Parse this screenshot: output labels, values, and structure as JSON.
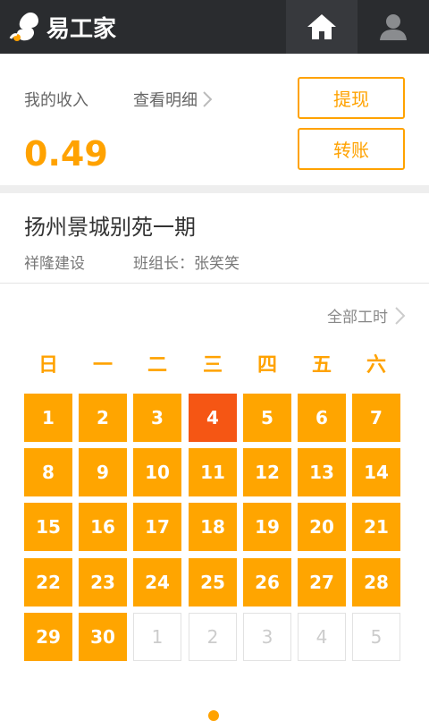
{
  "header": {
    "app_name": "易工家",
    "home_icon": "home-icon",
    "user_icon": "user-icon"
  },
  "income": {
    "label": "我的收入",
    "detail_link": "查看明细",
    "amount": "0.49",
    "withdraw_button": "提现",
    "transfer_button": "转账"
  },
  "project": {
    "name": "扬州景城别苑一期",
    "company": "祥隆建设",
    "leader": "班组长：张笑笑"
  },
  "all_hours_link": "全部工时",
  "calendar": {
    "weekdays": [
      "日",
      "一",
      "二",
      "三",
      "四",
      "五",
      "六"
    ],
    "rows": [
      [
        "1",
        "2",
        "3",
        "4",
        "5",
        "6",
        "7"
      ],
      [
        "8",
        "9",
        "10",
        "11",
        "12",
        "13",
        "14"
      ],
      [
        "15",
        "16",
        "17",
        "18",
        "19",
        "20",
        "21"
      ],
      [
        "22",
        "23",
        "24",
        "25",
        "26",
        "27",
        "28"
      ],
      [
        "29",
        "30",
        "1",
        "2",
        "3",
        "4",
        "5"
      ]
    ],
    "today": "4",
    "accent_color": "#ffa500",
    "today_color": "#f55614"
  }
}
